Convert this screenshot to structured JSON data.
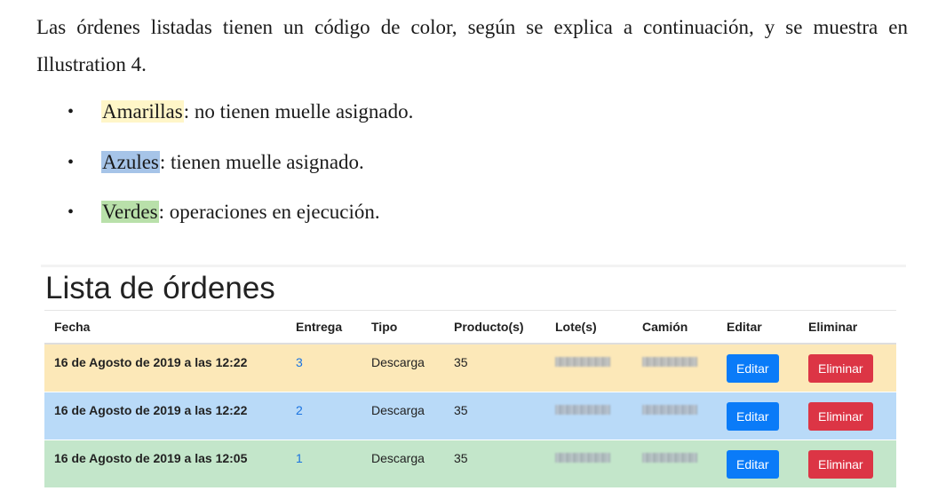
{
  "document": {
    "intro": "Las órdenes listadas tienen un código de color, según se explica a continuación, y se muestra en Illustration 4.",
    "bullet_symbol": "•",
    "bullets": [
      {
        "term": "Amarillas",
        "rest": ": no tienen muelle asignado.",
        "color": "#fff6c8"
      },
      {
        "term": "Azules",
        "rest": ": tienen muelle asignado.",
        "color": "#a6c4e8"
      },
      {
        "term": "Verdes",
        "rest": ": operaciones en ejecución.",
        "color": "#b9e0aa"
      }
    ]
  },
  "screenshot": {
    "title": "Lista de órdenes",
    "columns": [
      "Fecha",
      "Entrega",
      "Tipo",
      "Producto(s)",
      "Lote(s)",
      "Camión",
      "Editar",
      "Eliminar"
    ],
    "rows": [
      {
        "fecha": "16 de Agosto de 2019 a las 12:22",
        "entrega": "3",
        "tipo": "Descarga",
        "producto": "35",
        "row_color": "#fce8b8"
      },
      {
        "fecha": "16 de Agosto de 2019 a las 12:22",
        "entrega": "2",
        "tipo": "Descarga",
        "producto": "35",
        "row_color": "#b9daf8"
      },
      {
        "fecha": "16 de Agosto de 2019 a las 12:05",
        "entrega": "1",
        "tipo": "Descarga",
        "producto": "35",
        "row_color": "#c3e6ca"
      }
    ],
    "edit_label": "Editar",
    "delete_label": "Eliminar",
    "colors": {
      "edit_button": "#0a7bf8",
      "delete_button": "#dc3545",
      "link": "#1a73e0"
    }
  }
}
